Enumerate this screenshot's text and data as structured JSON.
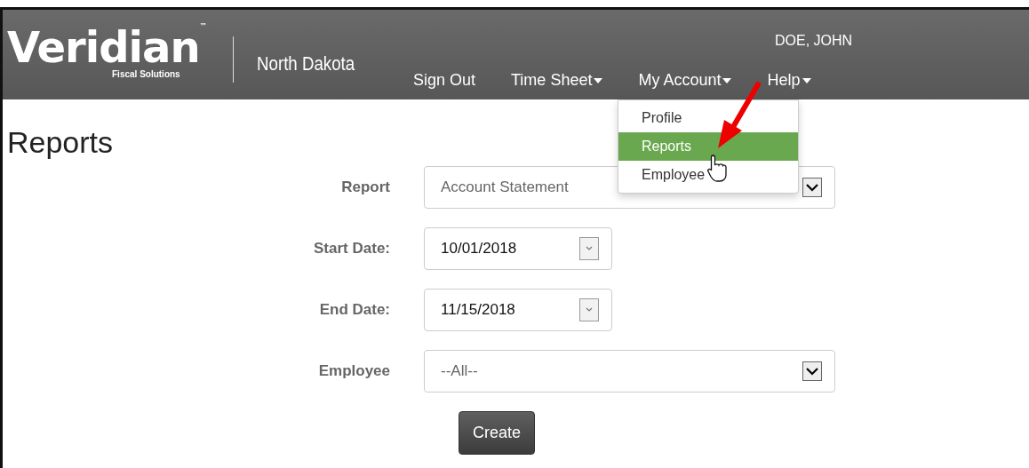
{
  "header": {
    "logo": {
      "name": "Veridian",
      "trademark": "™",
      "tagline": "Fiscal Solutions"
    },
    "region": "North Dakota",
    "user": "DOE, JOHN",
    "nav": [
      {
        "label": "Sign Out",
        "dropdown": false
      },
      {
        "label": "Time Sheet",
        "dropdown": true
      },
      {
        "label": "My Account",
        "dropdown": true
      },
      {
        "label": "Help",
        "dropdown": true
      }
    ]
  },
  "menu": {
    "items": [
      {
        "label": "Profile",
        "selected": false
      },
      {
        "label": "Reports",
        "selected": true
      },
      {
        "label": "Employee",
        "selected": false
      }
    ]
  },
  "page_title": "Reports",
  "form": {
    "fields": [
      {
        "label": "Report",
        "kind": "select",
        "value": "Account Statement"
      },
      {
        "label": "Start Date:",
        "kind": "date",
        "value": "10/01/2018"
      },
      {
        "label": "End Date:",
        "kind": "date",
        "value": "11/15/2018"
      },
      {
        "label": "Employee",
        "kind": "select",
        "value": "--All--"
      }
    ],
    "submit": "Create"
  }
}
